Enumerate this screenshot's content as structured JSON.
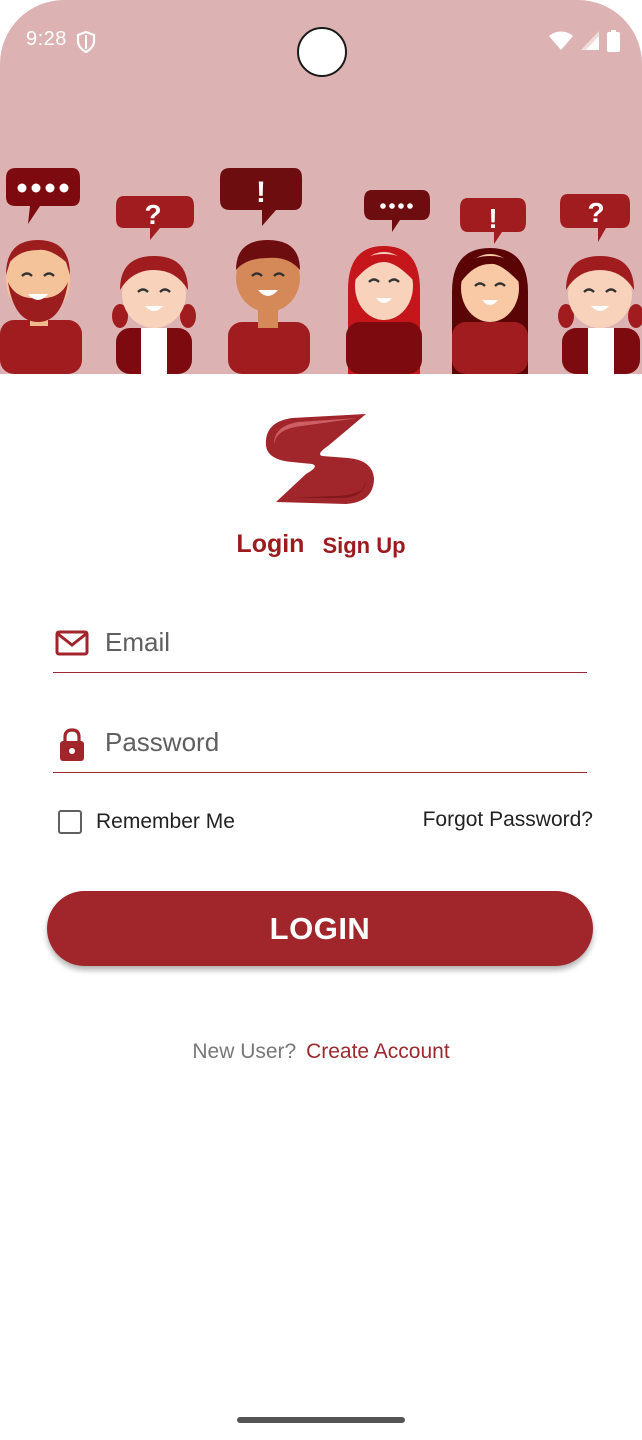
{
  "status_bar": {
    "time": "9:28"
  },
  "hero": {
    "background_color": "#dcb2b3",
    "illustration": "group-of-people-talking",
    "bubbles": [
      "....",
      "?",
      "!",
      "....",
      "!",
      "?"
    ]
  },
  "logo": {
    "icon": "s-shaped-brand-logo",
    "color": "#a0262c"
  },
  "tabs": {
    "login": "Login",
    "signup": "Sign Up"
  },
  "form": {
    "email": {
      "placeholder": "Email",
      "value": "",
      "icon": "mail-icon"
    },
    "password": {
      "placeholder": "Password",
      "value": "",
      "icon": "lock-icon"
    },
    "remember_me": {
      "label": "Remember Me",
      "checked": false
    },
    "forgot_password": "Forgot Password?",
    "login_button": "LOGIN"
  },
  "footer": {
    "prompt": "New User?",
    "link": "Create Account"
  },
  "colors": {
    "brand": "#a0262c",
    "brand_dark": "#9b1b1f"
  }
}
